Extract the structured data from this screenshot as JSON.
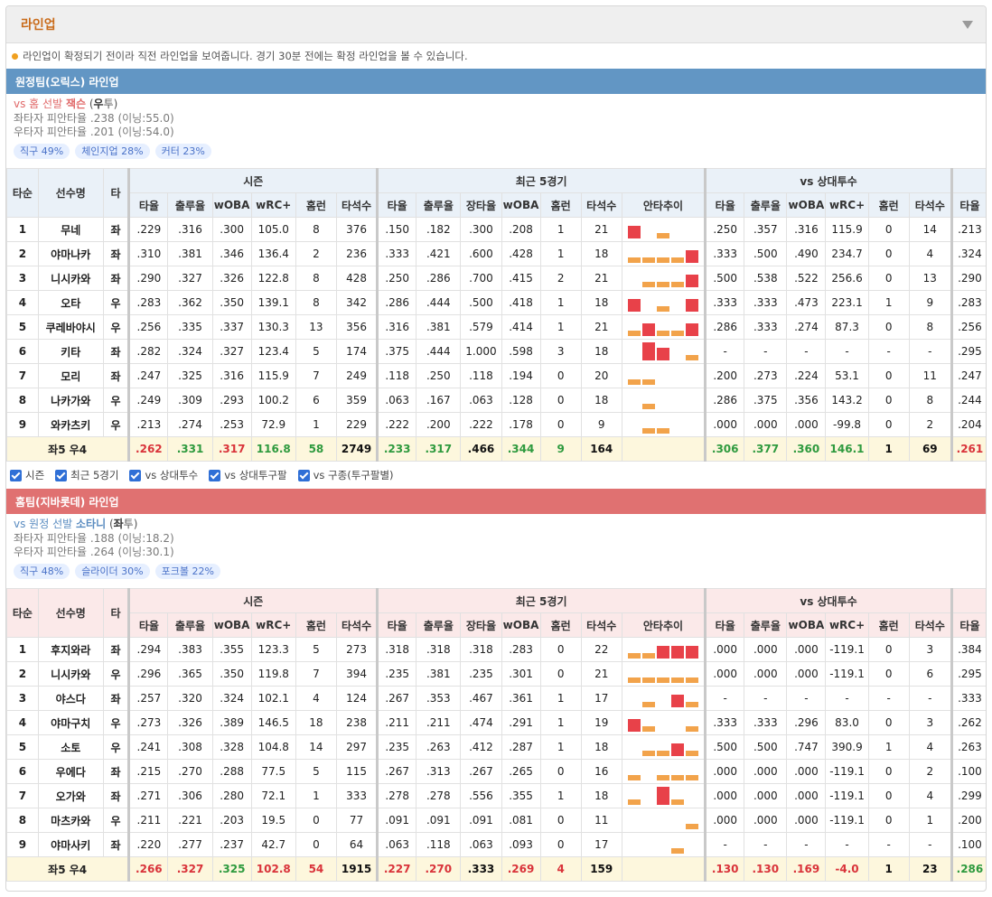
{
  "panel": {
    "title": "라인업"
  },
  "notice": "라인업이 확정되기 전이라 직전 라인업을 보여줍니다. 경기 30분 전에는 확정 라인업을 볼 수 있습니다.",
  "columns": {
    "order": "타순",
    "player": "선수명",
    "bat": "타",
    "groups": [
      "시즌",
      "최근 5경기",
      "vs 상대투수"
    ],
    "season": [
      "타율",
      "출루율",
      "wOBA",
      "wRC+",
      "홈런",
      "타석수"
    ],
    "recent": [
      "타율",
      "출루율",
      "장타율",
      "wOBA",
      "홈런",
      "타석수",
      "안타추이"
    ],
    "vs": [
      "타율",
      "출루율",
      "wOBA",
      "wRC+",
      "홈런",
      "타석수"
    ],
    "extra": "타율"
  },
  "checkboxes": [
    "시즌",
    "최근 5경기",
    "vs 상대투수",
    "vs 상대투구팔",
    "vs 구종(투구팔별)"
  ],
  "colors": {
    "away_header": "#6296c4",
    "home_header": "#e07171",
    "hit": "#e84149",
    "out": "#f2a34b"
  },
  "away": {
    "header": "원정팀(오릭스) 라인업",
    "pitcher": {
      "prefix": "vs 홈 선발",
      "name": "잭슨",
      "hand_open": "(",
      "hand": "우",
      "hand_rest": "투)",
      "vs_left": "좌타자 피안타율 .238 (이닝:55.0)",
      "vs_right": "우타자 피안타율 .201 (이닝:54.0)",
      "pitches": [
        "직구 49%",
        "체인지업 28%",
        "커터 23%"
      ]
    },
    "rows": [
      {
        "o": "1",
        "n": "무네",
        "b": "좌",
        "s": [
          ".229",
          ".316",
          ".300",
          "105.0",
          "8",
          "376"
        ],
        "r": [
          ".150",
          ".182",
          ".300",
          ".208",
          "1",
          "21"
        ],
        "v": [
          ".250",
          ".357",
          ".316",
          "115.9",
          "0",
          "14"
        ],
        "x": ".213",
        "t": [
          2,
          0,
          1,
          0,
          0
        ]
      },
      {
        "o": "2",
        "n": "야마나카",
        "b": "좌",
        "s": [
          ".310",
          ".381",
          ".346",
          "136.4",
          "2",
          "236"
        ],
        "r": [
          ".333",
          ".421",
          ".600",
          ".428",
          "1",
          "18"
        ],
        "v": [
          ".333",
          ".500",
          ".490",
          "234.7",
          "0",
          "4"
        ],
        "x": ".324",
        "t": [
          1,
          1,
          1,
          1,
          2
        ]
      },
      {
        "o": "3",
        "n": "니시카와",
        "b": "좌",
        "s": [
          ".290",
          ".327",
          ".326",
          "122.8",
          "8",
          "428"
        ],
        "r": [
          ".250",
          ".286",
          ".700",
          ".415",
          "2",
          "21"
        ],
        "v": [
          ".500",
          ".538",
          ".522",
          "256.6",
          "0",
          "13"
        ],
        "x": ".290",
        "t": [
          0,
          1,
          1,
          1,
          2
        ]
      },
      {
        "o": "4",
        "n": "오타",
        "b": "우",
        "s": [
          ".283",
          ".362",
          ".350",
          "139.1",
          "8",
          "342"
        ],
        "r": [
          ".286",
          ".444",
          ".500",
          ".418",
          "1",
          "18"
        ],
        "v": [
          ".333",
          ".333",
          ".473",
          "223.1",
          "1",
          "9"
        ],
        "x": ".283",
        "t": [
          2,
          0,
          1,
          0,
          2
        ]
      },
      {
        "o": "5",
        "n": "쿠레바야시",
        "b": "우",
        "s": [
          ".256",
          ".335",
          ".337",
          "130.3",
          "13",
          "356"
        ],
        "r": [
          ".316",
          ".381",
          ".579",
          ".414",
          "1",
          "21"
        ],
        "v": [
          ".286",
          ".333",
          ".274",
          "87.3",
          "0",
          "8"
        ],
        "x": ".256",
        "t": [
          1,
          2,
          1,
          1,
          2
        ]
      },
      {
        "o": "6",
        "n": "키타",
        "b": "좌",
        "s": [
          ".282",
          ".324",
          ".327",
          "123.4",
          "5",
          "174"
        ],
        "r": [
          ".375",
          ".444",
          "1.000",
          ".598",
          "3",
          "18"
        ],
        "v": [
          "-",
          "-",
          "-",
          "-",
          "-",
          "-"
        ],
        "x": ".295",
        "t": [
          0,
          3,
          2,
          0,
          1
        ]
      },
      {
        "o": "7",
        "n": "모리",
        "b": "좌",
        "s": [
          ".247",
          ".325",
          ".316",
          "115.9",
          "7",
          "249"
        ],
        "r": [
          ".118",
          ".250",
          ".118",
          ".194",
          "0",
          "20"
        ],
        "v": [
          ".200",
          ".273",
          ".224",
          "53.1",
          "0",
          "11"
        ],
        "x": ".247",
        "t": [
          1,
          1,
          0,
          0,
          0
        ]
      },
      {
        "o": "8",
        "n": "나카가와",
        "b": "우",
        "s": [
          ".249",
          ".309",
          ".293",
          "100.2",
          "6",
          "359"
        ],
        "r": [
          ".063",
          ".167",
          ".063",
          ".128",
          "0",
          "18"
        ],
        "v": [
          ".286",
          ".375",
          ".356",
          "143.2",
          "0",
          "8"
        ],
        "x": ".244",
        "t": [
          0,
          1,
          0,
          0,
          0
        ]
      },
      {
        "o": "9",
        "n": "와카츠키",
        "b": "우",
        "s": [
          ".213",
          ".274",
          ".253",
          "72.9",
          "1",
          "229"
        ],
        "r": [
          ".222",
          ".200",
          ".222",
          ".178",
          "0",
          "9"
        ],
        "v": [
          ".000",
          ".000",
          ".000",
          "-99.8",
          "0",
          "2"
        ],
        "x": ".204",
        "t": [
          0,
          1,
          1,
          0,
          0
        ]
      }
    ],
    "total": {
      "label_pre": "좌",
      "l": "5",
      "label_mid": " 우",
      "r": "4",
      "s": [
        ".262",
        ".331",
        ".317",
        "116.8",
        "58",
        "2749"
      ],
      "rc": [
        ".233",
        ".317",
        ".466",
        ".344",
        "9",
        "164"
      ],
      "v": [
        ".306",
        ".377",
        ".360",
        "146.1",
        "1",
        "69"
      ],
      "x": ".261"
    }
  },
  "home": {
    "header": "홈팀(지바롯데) 라인업",
    "pitcher": {
      "prefix": "vs 원정 선발",
      "name": "소타니",
      "hand_open": "(",
      "hand": "좌",
      "hand_rest": "투)",
      "vs_left": "좌타자 피안타율 .188 (이닝:18.2)",
      "vs_right": "우타자 피안타율 .264 (이닝:30.1)",
      "pitches": [
        "직구 48%",
        "슬라이더 30%",
        "포크볼 22%"
      ]
    },
    "rows": [
      {
        "o": "1",
        "n": "후지와라",
        "b": "좌",
        "s": [
          ".294",
          ".383",
          ".355",
          "123.3",
          "5",
          "273"
        ],
        "r": [
          ".318",
          ".318",
          ".318",
          ".283",
          "0",
          "22"
        ],
        "v": [
          ".000",
          ".000",
          ".000",
          "-119.1",
          "0",
          "3"
        ],
        "x": ".384",
        "t": [
          1,
          1,
          2,
          2,
          2
        ]
      },
      {
        "o": "2",
        "n": "니시카와",
        "b": "우",
        "s": [
          ".296",
          ".365",
          ".350",
          "119.8",
          "7",
          "394"
        ],
        "r": [
          ".235",
          ".381",
          ".235",
          ".301",
          "0",
          "21"
        ],
        "v": [
          ".000",
          ".000",
          ".000",
          "-119.1",
          "0",
          "6"
        ],
        "x": ".295",
        "t": [
          1,
          1,
          1,
          1,
          1
        ]
      },
      {
        "o": "3",
        "n": "야스다",
        "b": "좌",
        "s": [
          ".257",
          ".320",
          ".324",
          "102.1",
          "4",
          "124"
        ],
        "r": [
          ".267",
          ".353",
          ".467",
          ".361",
          "1",
          "17"
        ],
        "v": [
          "-",
          "-",
          "-",
          "-",
          "-",
          "-"
        ],
        "x": ".333",
        "t": [
          0,
          1,
          0,
          2,
          1
        ]
      },
      {
        "o": "4",
        "n": "야마구치",
        "b": "우",
        "s": [
          ".273",
          ".326",
          ".389",
          "146.5",
          "18",
          "238"
        ],
        "r": [
          ".211",
          ".211",
          ".474",
          ".291",
          "1",
          "19"
        ],
        "v": [
          ".333",
          ".333",
          ".296",
          "83.0",
          "0",
          "3"
        ],
        "x": ".262",
        "t": [
          2,
          1,
          0,
          0,
          1
        ]
      },
      {
        "o": "5",
        "n": "소토",
        "b": "우",
        "s": [
          ".241",
          ".308",
          ".328",
          "104.8",
          "14",
          "297"
        ],
        "r": [
          ".235",
          ".263",
          ".412",
          ".287",
          "1",
          "18"
        ],
        "v": [
          ".500",
          ".500",
          ".747",
          "390.9",
          "1",
          "4"
        ],
        "x": ".263",
        "t": [
          0,
          1,
          1,
          2,
          1
        ]
      },
      {
        "o": "6",
        "n": "우에다",
        "b": "좌",
        "s": [
          ".215",
          ".270",
          ".288",
          "77.5",
          "5",
          "115"
        ],
        "r": [
          ".267",
          ".313",
          ".267",
          ".265",
          "0",
          "16"
        ],
        "v": [
          ".000",
          ".000",
          ".000",
          "-119.1",
          "0",
          "2"
        ],
        "x": ".100",
        "t": [
          1,
          0,
          1,
          1,
          1
        ]
      },
      {
        "o": "7",
        "n": "오가와",
        "b": "좌",
        "s": [
          ".271",
          ".306",
          ".280",
          "72.1",
          "1",
          "333"
        ],
        "r": [
          ".278",
          ".278",
          ".556",
          ".355",
          "1",
          "18"
        ],
        "v": [
          ".000",
          ".000",
          ".000",
          "-119.1",
          "0",
          "4"
        ],
        "x": ".299",
        "t": [
          1,
          0,
          3,
          1,
          0
        ]
      },
      {
        "o": "8",
        "n": "마츠카와",
        "b": "우",
        "s": [
          ".211",
          ".221",
          ".203",
          "19.5",
          "0",
          "77"
        ],
        "r": [
          ".091",
          ".091",
          ".091",
          ".081",
          "0",
          "11"
        ],
        "v": [
          ".000",
          ".000",
          ".000",
          "-119.1",
          "0",
          "1"
        ],
        "x": ".200",
        "t": [
          0,
          0,
          0,
          0,
          1
        ]
      },
      {
        "o": "9",
        "n": "야마사키",
        "b": "좌",
        "s": [
          ".220",
          ".277",
          ".237",
          "42.7",
          "0",
          "64"
        ],
        "r": [
          ".063",
          ".118",
          ".063",
          ".093",
          "0",
          "17"
        ],
        "v": [
          "-",
          "-",
          "-",
          "-",
          "-",
          "-"
        ],
        "x": ".100",
        "t": [
          0,
          0,
          0,
          1,
          0
        ]
      }
    ],
    "total": {
      "label_pre": "좌",
      "l": "5",
      "label_mid": " 우",
      "r": "4",
      "s": [
        ".266",
        ".327",
        ".325",
        "102.8",
        "54",
        "1915"
      ],
      "rc": [
        ".227",
        ".270",
        ".333",
        ".269",
        "4",
        "159"
      ],
      "v": [
        ".130",
        ".130",
        ".169",
        "-4.0",
        "1",
        "23"
      ],
      "x": ".286"
    }
  }
}
